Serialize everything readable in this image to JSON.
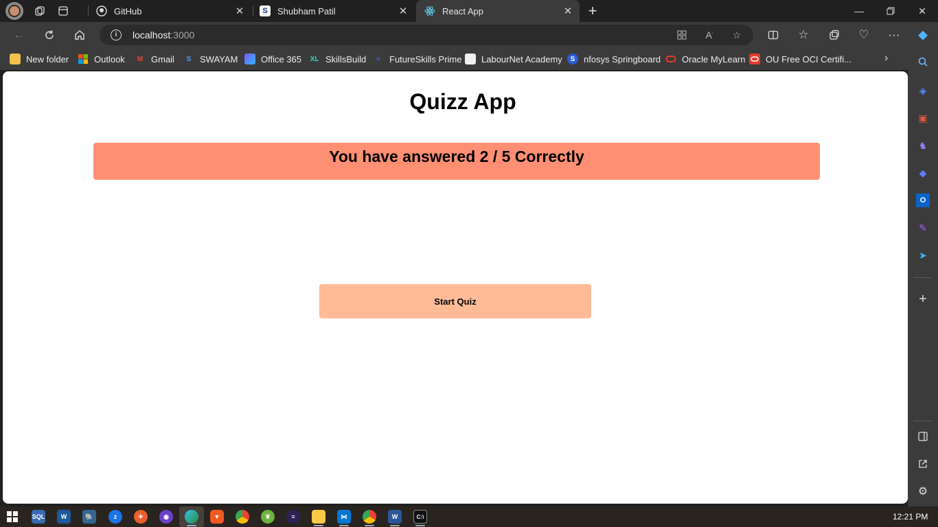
{
  "browser": {
    "tabs": [
      {
        "title": "GitHub",
        "favicon": "github-icon",
        "active": false
      },
      {
        "title": "Shubham Patil",
        "favicon": "s-icon",
        "active": false
      },
      {
        "title": "React App",
        "favicon": "react-icon",
        "active": true
      }
    ],
    "address": {
      "host": "localhost",
      "port": ":3000"
    },
    "bookmarks": [
      {
        "label": "New folder",
        "icon": "folder-icon"
      },
      {
        "label": "Outlook",
        "icon": "microsoft-icon"
      },
      {
        "label": "Gmail",
        "icon": "gmail-icon"
      },
      {
        "label": "SWAYAM",
        "icon": "swayam-icon"
      },
      {
        "label": "Office 365",
        "icon": "office-icon"
      },
      {
        "label": "SkillsBuild",
        "icon": "skillsbuild-icon"
      },
      {
        "label": "FutureSkills Prime",
        "icon": "futureskills-icon"
      },
      {
        "label": "LabourNet Academy",
        "icon": "page-icon"
      },
      {
        "label": "nfosys Springboard",
        "icon": "springboard-icon"
      },
      {
        "label": "Oracle MyLearn",
        "icon": "oracle-icon"
      },
      {
        "label": "OU Free OCI Certifi...",
        "icon": "oracle-icon"
      }
    ]
  },
  "app": {
    "title": "Quizz App",
    "result_message": "You have answered 2 / 5 Correctly",
    "start_button": "Start Quiz"
  },
  "colors": {
    "result_bg": "#ff8f73",
    "button_bg": "#ffbb98"
  },
  "taskbar": {
    "time": "12:21 PM"
  }
}
